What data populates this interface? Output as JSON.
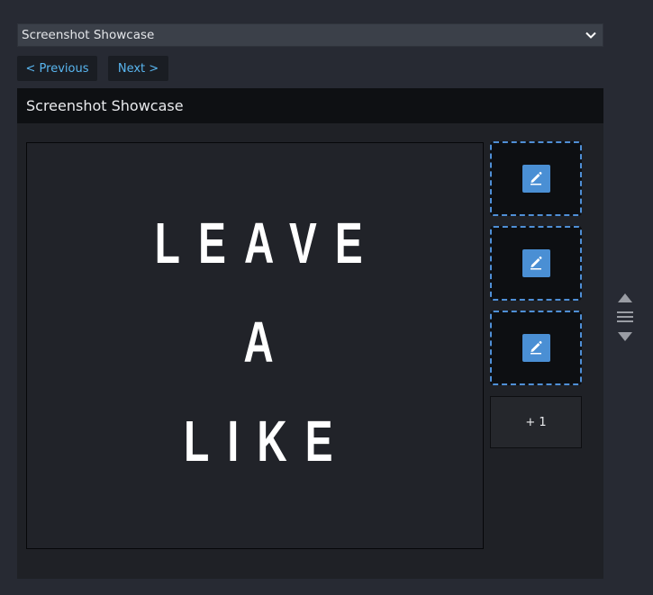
{
  "showcase_select": {
    "selected": "Screenshot Showcase"
  },
  "nav": {
    "previous_label": "< Previous",
    "next_label": "Next >"
  },
  "panel": {
    "title": "Screenshot Showcase"
  },
  "main_screenshot": {
    "lines": [
      "LEAVE",
      "A",
      "LIKE"
    ]
  },
  "thumbnails": [
    {
      "icon": "pencil-edit-icon"
    },
    {
      "icon": "pencil-edit-icon"
    },
    {
      "icon": "pencil-edit-icon"
    }
  ],
  "more_tile": {
    "label": "+ 1"
  },
  "reorder_controls": {
    "icons": [
      "move-up-icon",
      "drag-handle-icon",
      "move-down-icon"
    ]
  },
  "colors": {
    "accent": "#4a8fd4",
    "link": "#59b6f0",
    "background": "#272a33",
    "panel": "#1f2126"
  }
}
